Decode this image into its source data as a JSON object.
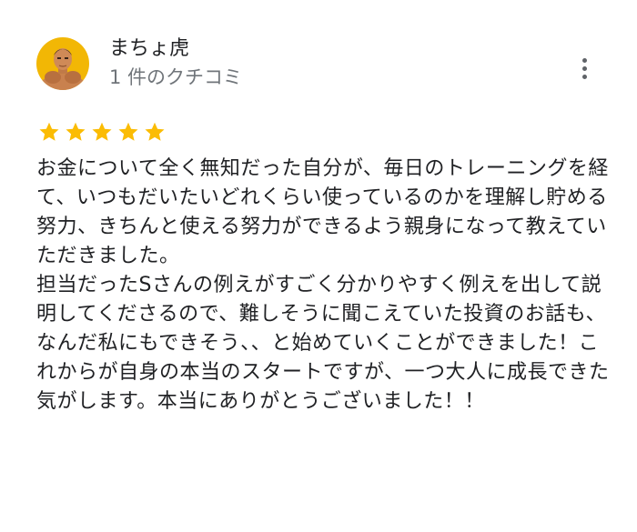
{
  "reviewer": {
    "name": "まちょ虎",
    "review_count": "1 件のクチコミ",
    "avatar_icon": "muscle-man-avatar"
  },
  "menu": {
    "icon": "more-vert-icon"
  },
  "rating": {
    "stars": 5,
    "max": 5,
    "color": "#fbbc04"
  },
  "review": {
    "text": "お金について全く無知だった自分が、毎日のトレーニングを経て、いつもだいたいどれくらい使っているのかを理解し貯める努力、きちんと使える努力ができるよう親身になって教えていただきました。\n担当だったSさんの例えがすごく分かりやすく例えを出して説明してくださるので、難しそうに聞こえていた投資のお話も、なんだ私にもできそう、、と始めていくことができました！これからが自身の本当のスタートですが、一つ大人に成長できた気がします。本当にありがとうございました！！"
  }
}
